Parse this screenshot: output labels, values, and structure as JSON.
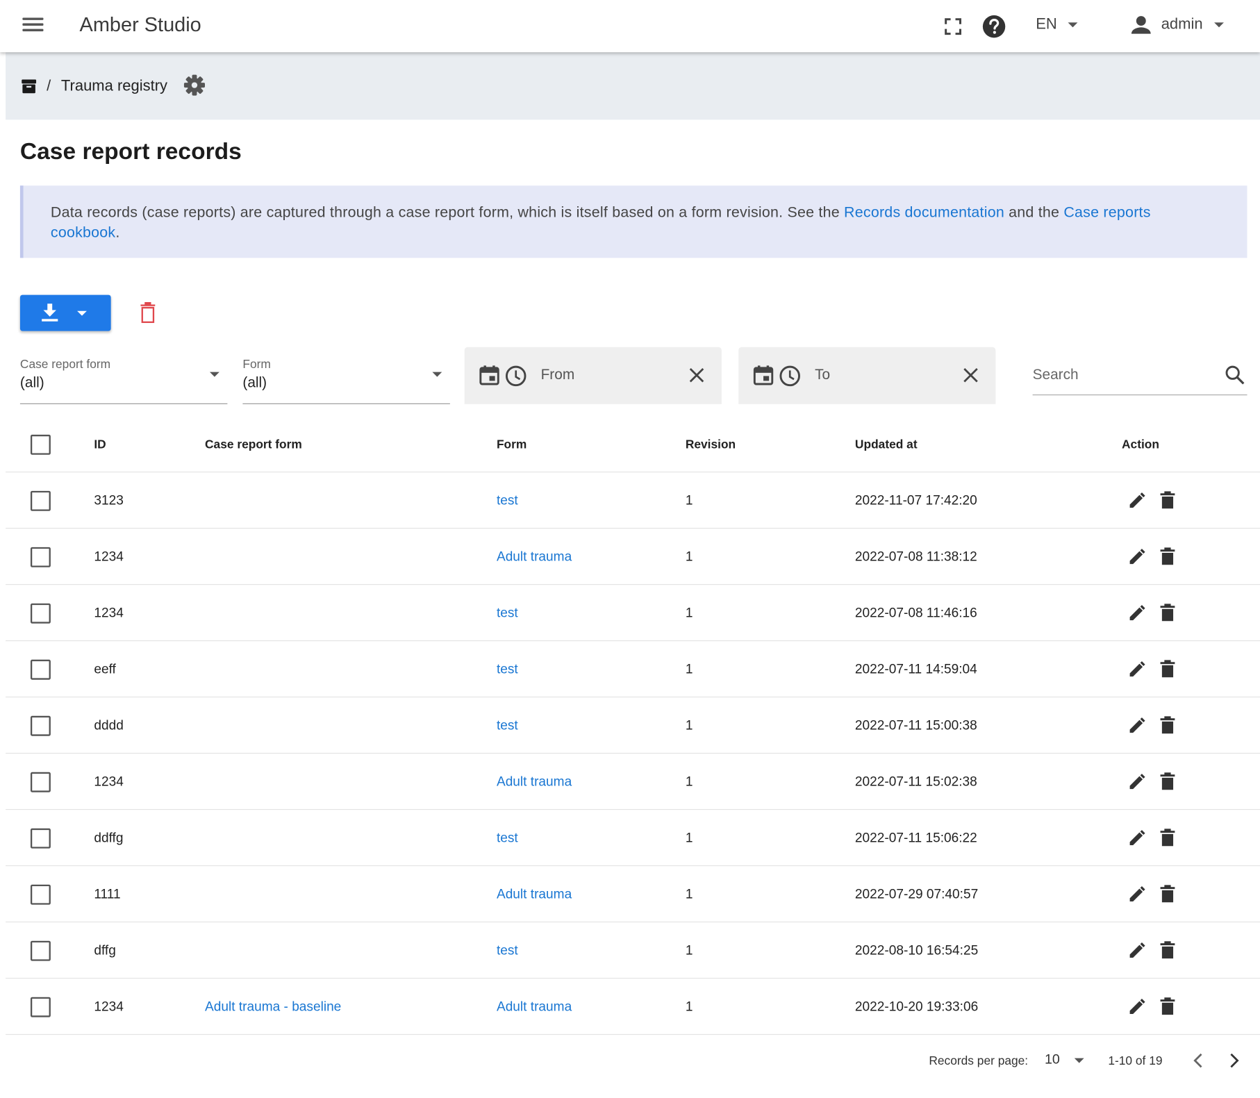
{
  "app": {
    "title": "Amber Studio"
  },
  "topbar": {
    "language": "EN",
    "user": "admin"
  },
  "breadcrumb": {
    "label": "Trauma registry",
    "separator": "/"
  },
  "page": {
    "title": "Case report records"
  },
  "info": {
    "text1": "Data records (case reports) are captured through a case report form, which is itself based on a form revision. See the ",
    "link1": "Records documentation",
    "text2": " and the ",
    "link2": "Case reports cookbook",
    "text3": "."
  },
  "filters": {
    "case_report_form": {
      "label": "Case report form",
      "value": "(all)"
    },
    "form": {
      "label": "Form",
      "value": "(all)"
    },
    "from_placeholder": "From",
    "to_placeholder": "To",
    "search_placeholder": "Search"
  },
  "table": {
    "headers": {
      "id": "ID",
      "crf": "Case report form",
      "form": "Form",
      "revision": "Revision",
      "updated": "Updated at",
      "action": "Action"
    },
    "rows": [
      {
        "id": "3123",
        "crf": "",
        "form": "test",
        "revision": "1",
        "updated": "2022-11-07 17:42:20"
      },
      {
        "id": "1234",
        "crf": "",
        "form": "Adult trauma",
        "revision": "1",
        "updated": "2022-07-08 11:38:12"
      },
      {
        "id": "1234",
        "crf": "",
        "form": "test",
        "revision": "1",
        "updated": "2022-07-08 11:46:16"
      },
      {
        "id": "eeff",
        "crf": "",
        "form": "test",
        "revision": "1",
        "updated": "2022-07-11 14:59:04"
      },
      {
        "id": "dddd",
        "crf": "",
        "form": "test",
        "revision": "1",
        "updated": "2022-07-11 15:00:38"
      },
      {
        "id": "1234",
        "crf": "",
        "form": "Adult trauma",
        "revision": "1",
        "updated": "2022-07-11 15:02:38"
      },
      {
        "id": "ddffg",
        "crf": "",
        "form": "test",
        "revision": "1",
        "updated": "2022-07-11 15:06:22"
      },
      {
        "id": "1111",
        "crf": "",
        "form": "Adult trauma",
        "revision": "1",
        "updated": "2022-07-29 07:40:57"
      },
      {
        "id": "dffg",
        "crf": "",
        "form": "test",
        "revision": "1",
        "updated": "2022-08-10 16:54:25"
      },
      {
        "id": "1234",
        "crf": "Adult trauma - baseline",
        "form": "Adult trauma",
        "revision": "1",
        "updated": "2022-10-20 19:33:06"
      }
    ]
  },
  "pagination": {
    "records_per_page_label": "Records per page:",
    "records_per_page": "10",
    "range": "1-10 of 19"
  },
  "icons": {
    "menu": "menu-icon",
    "fullscreen": "fullscreen-icon",
    "help": "help-icon",
    "user": "person-icon",
    "archive": "archive-icon",
    "settings": "gear-icon",
    "download": "download-icon",
    "delete": "trash-icon",
    "calendar": "calendar-icon",
    "clock": "clock-icon",
    "clear": "close-icon",
    "search": "search-icon",
    "edit": "pencil-icon",
    "prev": "chevron-left-icon",
    "next": "chevron-right-icon"
  },
  "colors": {
    "primary": "#1f7ae8",
    "link": "#1976d2",
    "danger": "#e0474c",
    "info_bg": "#e5e8f7",
    "crumb_bg": "#e9edf1"
  }
}
